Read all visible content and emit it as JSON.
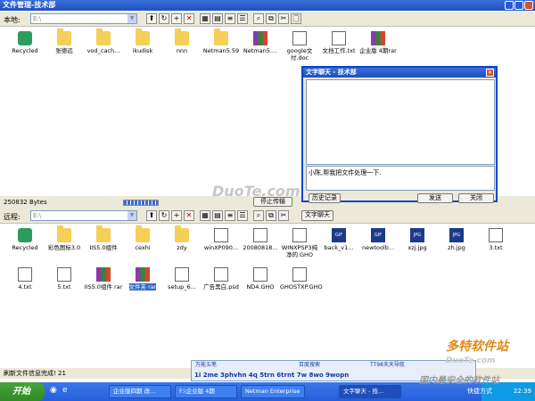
{
  "window": {
    "title": "文件管理-技术部"
  },
  "local": {
    "label": "本地:",
    "path": "E:\\"
  },
  "remote": {
    "label": "远程:",
    "path": "E:\\"
  },
  "local_files": [
    "Recycled",
    "张德远",
    "vod_cach...",
    "ikudisk",
    "nnn",
    "Netman5.59",
    "Netman5....",
    "google文付.doc",
    "文挡工作.txt",
    "企业版 4期rar"
  ],
  "status": {
    "bytes": "250832 Bytes",
    "stop_button": "停止传输",
    "chat_button": "文字聊天"
  },
  "remote_files_row1": [
    "Recycled",
    "彩色图标3.0",
    "IIS5.0组件",
    "cexhi",
    "zdy",
    "winXP090...",
    "20080818...",
    "WINXPSP3纯净的.GHO",
    "back_v1...",
    "newtoolb...",
    "xzj.jpg",
    "zh.jpg",
    "3.txt"
  ],
  "remote_files_row2": [
    "4.txt",
    "5.txt",
    "IIS5.0组件 rar",
    "文件夹 rar",
    "setup_6...",
    "广告黑白.psd",
    "ND4.GHO",
    "GHOSTXP.GHO"
  ],
  "chat": {
    "title": "文字聊天 - 技术部",
    "message": "小陈,帮我把文件处理一下.",
    "history_button": "历史记录",
    "send_button": "发送",
    "close_button": "关闭"
  },
  "footer": {
    "status": "刷新文件信息完成! 21"
  },
  "ime": {
    "tab1": "万能五笔",
    "tab2": "百度搜索",
    "tab3": "TT98天天导航",
    "candidates": "1i 2me 3phvhn 4q 5trn 6trnt 7w 8wo 9wopn"
  },
  "taskbar": {
    "start": "开始",
    "tasks": [
      "企业版四期 改...",
      "F:\\企业版 4期",
      "Netman Enterprise",
      "文字聊天 - 技..."
    ],
    "active_index": 3,
    "clock": "22:39",
    "tray_text": "快捷方式"
  },
  "watermarks": [
    "DuoTe.com",
    "多特软件站",
    "DuoTe.com",
    "国内最安全的软件站"
  ]
}
